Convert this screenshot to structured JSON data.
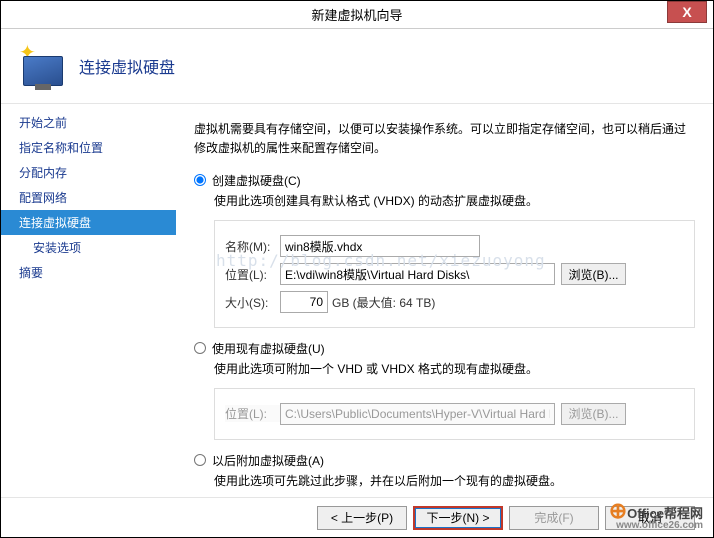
{
  "window": {
    "title": "新建虚拟机向导",
    "close": "X"
  },
  "header": {
    "title": "连接虚拟硬盘"
  },
  "sidebar": {
    "items": [
      {
        "label": "开始之前"
      },
      {
        "label": "指定名称和位置"
      },
      {
        "label": "分配内存"
      },
      {
        "label": "配置网络"
      },
      {
        "label": "连接虚拟硬盘"
      },
      {
        "label": "安装选项"
      },
      {
        "label": "摘要"
      }
    ]
  },
  "content": {
    "intro": "虚拟机需要具有存储空间，以便可以安装操作系统。可以立即指定存储空间，也可以稍后通过修改虚拟机的属性来配置存储空间。",
    "opt1": {
      "label": "创建虚拟硬盘(C)",
      "desc": "使用此选项创建具有默认格式 (VHDX) 的动态扩展虚拟硬盘。",
      "name_label": "名称(M):",
      "name_value": "win8模版.vhdx",
      "loc_label": "位置(L):",
      "loc_value": "E:\\vdi\\win8模版\\Virtual Hard Disks\\",
      "browse": "浏览(B)...",
      "size_label": "大小(S):",
      "size_value": "70",
      "size_after": "GB (最大值: 64 TB)"
    },
    "opt2": {
      "label": "使用现有虚拟硬盘(U)",
      "desc": "使用此选项可附加一个 VHD 或 VHDX 格式的现有虚拟硬盘。",
      "loc_label": "位置(L):",
      "loc_value": "C:\\Users\\Public\\Documents\\Hyper-V\\Virtual Hard Disks\\",
      "browse": "浏览(B)..."
    },
    "opt3": {
      "label": "以后附加虚拟硬盘(A)",
      "desc": "使用此选项可先跳过此步骤，并在以后附加一个现有的虚拟硬盘。"
    }
  },
  "footer": {
    "prev": "< 上一步(P)",
    "next": "下一步(N) >",
    "finish": "完成(F)",
    "cancel": "取消"
  },
  "watermark": "http://blog.csdn.net/xiezuoyong",
  "brand": {
    "name": "Office帮程网",
    "url": "www.office26.com"
  }
}
